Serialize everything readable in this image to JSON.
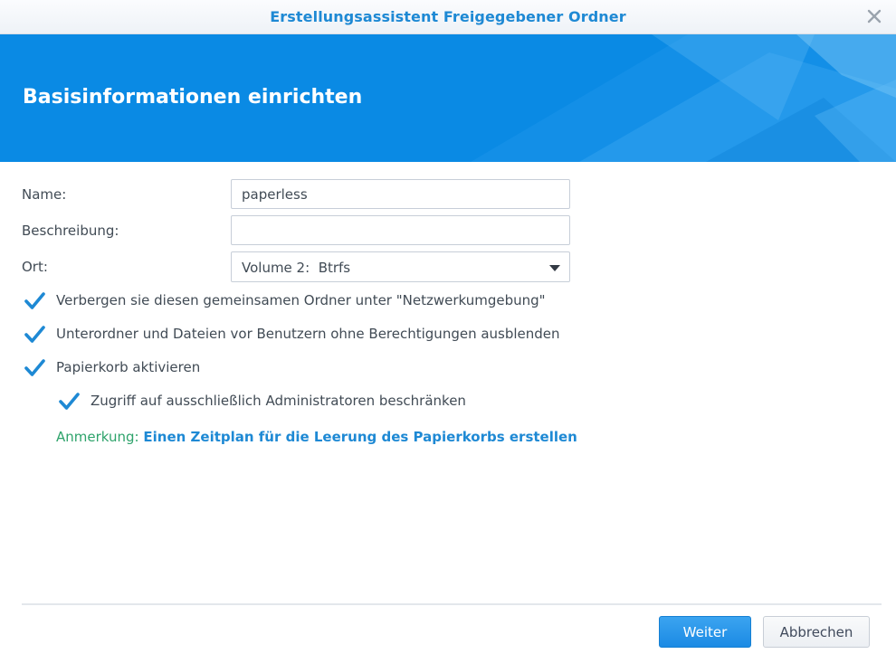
{
  "window": {
    "title": "Erstellungsassistent Freigegebener Ordner",
    "close_icon": "close-icon"
  },
  "banner": {
    "heading": "Basisinformationen einrichten",
    "color": "#0a8ae4"
  },
  "form": {
    "name_label": "Name:",
    "name_value": "paperless",
    "description_label": "Beschreibung:",
    "description_value": "",
    "location_label": "Ort:",
    "location_value": "Volume 2:  Btrfs"
  },
  "options": {
    "hide_network": {
      "label": "Verbergen sie diesen gemeinsamen Ordner unter \"Netzwerkumgebung\"",
      "checked": true
    },
    "hide_subfolders": {
      "label": "Unterordner und Dateien vor Benutzern ohne Berechtigungen ausblenden",
      "checked": true
    },
    "recycle_bin": {
      "label": "Papierkorb aktivieren",
      "checked": true
    },
    "admin_only": {
      "label": "Zugriff auf ausschließlich Administratoren beschränken",
      "checked": true
    }
  },
  "note": {
    "prefix": "Anmerkung:",
    "link": "Einen Zeitplan für die Leerung des Papierkorbs erstellen"
  },
  "footer": {
    "next_label": "Weiter",
    "cancel_label": "Abbrechen"
  },
  "colors": {
    "accent": "#1e89d4",
    "note_green": "#2ea36b",
    "primary_button": "#1b8ae4"
  }
}
